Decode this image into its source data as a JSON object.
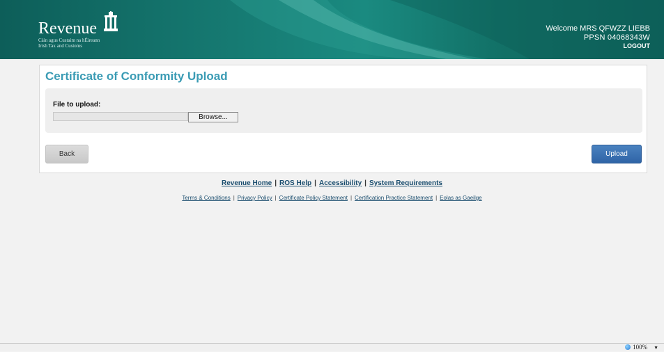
{
  "header": {
    "logo": {
      "word": "Revenue",
      "subtitle_irish": "Cáin agus Custaim na hÉireann",
      "subtitle_english": "Irish Tax and Customs"
    },
    "welcome_text": "Welcome MRS QFWZZ LIEBB",
    "ppsn_text": "PPSN 04068343W",
    "logout_label": "LOGOUT"
  },
  "main": {
    "title": "Certificate of Conformity Upload",
    "file_label": "File to upload:",
    "file_value": "",
    "browse_label": "Browse...",
    "back_label": "Back",
    "upload_label": "Upload"
  },
  "footer": {
    "primary_links": [
      "Revenue Home",
      "ROS Help",
      "Accessibility",
      "System Requirements"
    ],
    "secondary_links": [
      "Terms & Conditions",
      "Privacy Policy",
      "Certificate Policy Statement",
      "Certification Practice Statement",
      "Eolas as Gaeilge"
    ],
    "separator": "|"
  },
  "statusbar": {
    "zoom_level": "100%",
    "zoom_caret": "▼"
  },
  "colors": {
    "header_bg": "#127167",
    "title_color": "#3a9bb4",
    "upload_button": "#3a6fb0",
    "back_button": "#d2d2d2",
    "link_color": "#1a4d6e"
  },
  "icons": {
    "logo": "harp-building-icon",
    "zoom": "globe-icon",
    "zoom_dropdown": "chevron-down-icon"
  }
}
